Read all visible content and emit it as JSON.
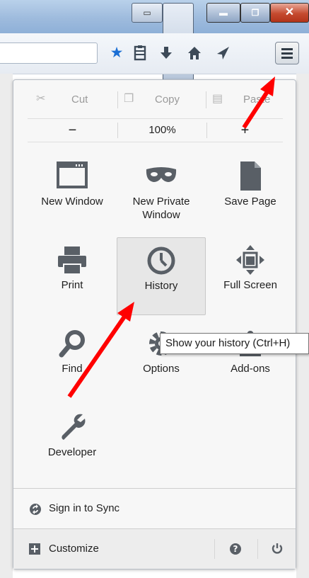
{
  "toolbar": {
    "icons": [
      "star-icon",
      "reading-list-icon",
      "download-icon",
      "home-icon",
      "send-icon",
      "hamburger-menu-icon"
    ]
  },
  "edit": {
    "cut": "Cut",
    "copy": "Copy",
    "paste": "Paste"
  },
  "zoom": {
    "minus": "−",
    "level": "100%",
    "plus": "+"
  },
  "tiles": [
    {
      "label": "New Window",
      "icon": "window-icon"
    },
    {
      "label": "New Private Window",
      "icon": "mask-icon"
    },
    {
      "label": "Save Page",
      "icon": "page-icon"
    },
    {
      "label": "Print",
      "icon": "printer-icon"
    },
    {
      "label": "History",
      "icon": "clock-icon"
    },
    {
      "label": "Full Screen",
      "icon": "fullscreen-icon"
    },
    {
      "label": "Find",
      "icon": "magnifier-icon"
    },
    {
      "label": "Options",
      "icon": "gear-icon"
    },
    {
      "label": "Add-ons",
      "icon": "puzzle-icon"
    },
    {
      "label": "Developer",
      "icon": "wrench-icon"
    }
  ],
  "footer": {
    "sync": "Sign in to Sync",
    "customize": "Customize"
  },
  "tooltip": "Show your history (Ctrl+H)",
  "colors": {
    "accent_star": "#1c6fd4",
    "arrow": "#ff0000",
    "close_button": "#c54a2f"
  }
}
